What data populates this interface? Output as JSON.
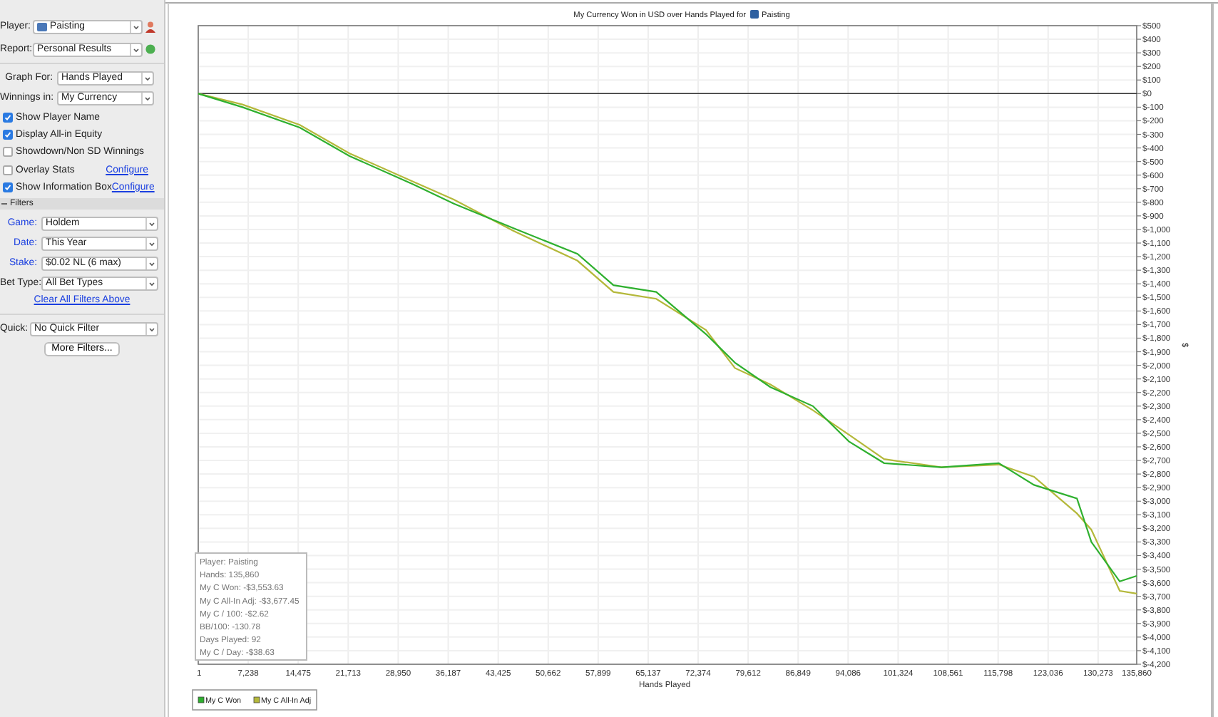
{
  "sidebar": {
    "player": {
      "label": "Player:",
      "value": "Paisting"
    },
    "report": {
      "label": "Report:",
      "value": "Personal Results"
    },
    "graph_for": {
      "label": "Graph For:",
      "value": "Hands Played"
    },
    "winnings_in": {
      "label": "Winnings in:",
      "value": "My Currency"
    },
    "options": [
      {
        "label": "Show Player Name",
        "checked": true
      },
      {
        "label": "Display All-in Equity",
        "checked": true
      },
      {
        "label": "Showdown/Non SD Winnings",
        "checked": false
      },
      {
        "label": "Overlay Stats",
        "checked": false,
        "link": "Configure"
      },
      {
        "label": "Show Information Box",
        "checked": true,
        "link": "Configure"
      }
    ],
    "filters": {
      "title": "Filters",
      "fields": [
        {
          "label": "Game:",
          "value": "Holdem",
          "linked": true
        },
        {
          "label": "Date:",
          "value": "This Year",
          "linked": true
        },
        {
          "label": "Stake:",
          "value": "$0.02 NL (6 max)",
          "linked": true
        },
        {
          "label": "Bet Type:",
          "value": "All Bet Types",
          "linked": false
        }
      ],
      "clear_link": "Clear All Filters Above",
      "quick": {
        "label": "Quick:",
        "value": "No Quick Filter"
      },
      "more_button": "More Filters..."
    }
  },
  "chart": {
    "title": "My Currency Won in USD over Hands Played for",
    "player": "Paisting",
    "info_box": [
      "Player: Paisting",
      "Hands: 135,860",
      "My C Won: -$3,553.63",
      "My C All-In Adj: -$3,677.45",
      "My C / 100: -$2.62",
      "BB/100: -130.78",
      "Days Played: 92",
      "My C / Day: -$38.63"
    ],
    "chart_data": {
      "type": "line",
      "xlabel": "Hands Played",
      "ylabel": "$",
      "grid": true,
      "legend": "bottom-left",
      "x": [
        1,
        6400,
        14700,
        21900,
        31200,
        37000,
        45600,
        54900,
        60100,
        66300,
        73500,
        77700,
        82800,
        89000,
        94200,
        99300,
        107600,
        115900,
        121000,
        127200,
        129300,
        133400,
        135860
      ],
      "series": [
        {
          "name": "My C Won",
          "color": "#2fb02f",
          "values": [
            0,
            -100,
            -250,
            -460,
            -670,
            -810,
            -990,
            -1180,
            -1410,
            -1460,
            -1770,
            -1980,
            -2160,
            -2300,
            -2560,
            -2720,
            -2750,
            -2720,
            -2880,
            -2980,
            -3300,
            -3590,
            -3550
          ]
        },
        {
          "name": "My C All-In Adj",
          "color": "#b4b83a",
          "values": [
            0,
            -80,
            -230,
            -440,
            -650,
            -780,
            -1010,
            -1230,
            -1460,
            -1510,
            -1740,
            -2020,
            -2140,
            -2330,
            -2510,
            -2690,
            -2750,
            -2730,
            -2820,
            -3090,
            -3210,
            -3660,
            -3680
          ]
        }
      ],
      "xlim": [
        1,
        135860
      ],
      "ylim": [
        -4200,
        500
      ],
      "xticks": [
        {
          "value": 1,
          "label": "1"
        },
        {
          "value": 7238,
          "label": "7,238"
        },
        {
          "value": 14475,
          "label": "14,475"
        },
        {
          "value": 21713,
          "label": "21,713"
        },
        {
          "value": 28950,
          "label": "28,950"
        },
        {
          "value": 36187,
          "label": "36,187"
        },
        {
          "value": 43425,
          "label": "43,425"
        },
        {
          "value": 50662,
          "label": "50,662"
        },
        {
          "value": 57899,
          "label": "57,899"
        },
        {
          "value": 65137,
          "label": "65,137"
        },
        {
          "value": 72374,
          "label": "72,374"
        },
        {
          "value": 79612,
          "label": "79,612"
        },
        {
          "value": 86849,
          "label": "86,849"
        },
        {
          "value": 94086,
          "label": "94,086"
        },
        {
          "value": 101324,
          "label": "101,324"
        },
        {
          "value": 108561,
          "label": "108,561"
        },
        {
          "value": 115798,
          "label": "115,798"
        },
        {
          "value": 123036,
          "label": "123,036"
        },
        {
          "value": 130273,
          "label": "130,273"
        },
        {
          "value": 135860,
          "label": "135,860"
        }
      ],
      "yticks": [
        {
          "value": 500,
          "label": "$500"
        },
        {
          "value": 400,
          "label": "$400"
        },
        {
          "value": 300,
          "label": "$300"
        },
        {
          "value": 200,
          "label": "$200"
        },
        {
          "value": 100,
          "label": "$100"
        },
        {
          "value": 0,
          "label": "$0"
        },
        {
          "value": -100,
          "label": "$-100"
        },
        {
          "value": -200,
          "label": "$-200"
        },
        {
          "value": -300,
          "label": "$-300"
        },
        {
          "value": -400,
          "label": "$-400"
        },
        {
          "value": -500,
          "label": "$-500"
        },
        {
          "value": -600,
          "label": "$-600"
        },
        {
          "value": -700,
          "label": "$-700"
        },
        {
          "value": -800,
          "label": "$-800"
        },
        {
          "value": -900,
          "label": "$-900"
        },
        {
          "value": -1000,
          "label": "$-1,000"
        },
        {
          "value": -1100,
          "label": "$-1,100"
        },
        {
          "value": -1200,
          "label": "$-1,200"
        },
        {
          "value": -1300,
          "label": "$-1,300"
        },
        {
          "value": -1400,
          "label": "$-1,400"
        },
        {
          "value": -1500,
          "label": "$-1,500"
        },
        {
          "value": -1600,
          "label": "$-1,600"
        },
        {
          "value": -1700,
          "label": "$-1,700"
        },
        {
          "value": -1800,
          "label": "$-1,800"
        },
        {
          "value": -1900,
          "label": "$-1,900"
        },
        {
          "value": -2000,
          "label": "$-2,000"
        },
        {
          "value": -2100,
          "label": "$-2,100"
        },
        {
          "value": -2200,
          "label": "$-2,200"
        },
        {
          "value": -2300,
          "label": "$-2,300"
        },
        {
          "value": -2400,
          "label": "$-2,400"
        },
        {
          "value": -2500,
          "label": "$-2,500"
        },
        {
          "value": -2600,
          "label": "$-2,600"
        },
        {
          "value": -2700,
          "label": "$-2,700"
        },
        {
          "value": -2800,
          "label": "$-2,800"
        },
        {
          "value": -2900,
          "label": "$-2,900"
        },
        {
          "value": -3000,
          "label": "$-3,000"
        },
        {
          "value": -3100,
          "label": "$-3,100"
        },
        {
          "value": -3200,
          "label": "$-3,200"
        },
        {
          "value": -3300,
          "label": "$-3,300"
        },
        {
          "value": -3400,
          "label": "$-3,400"
        },
        {
          "value": -3500,
          "label": "$-3,500"
        },
        {
          "value": -3600,
          "label": "$-3,600"
        },
        {
          "value": -3700,
          "label": "$-3,700"
        },
        {
          "value": -3800,
          "label": "$-3,800"
        },
        {
          "value": -3900,
          "label": "$-3,900"
        },
        {
          "value": -4000,
          "label": "$-4,000"
        },
        {
          "value": -4100,
          "label": "$-4,100"
        },
        {
          "value": -4200,
          "label": "$-4,200"
        }
      ]
    }
  }
}
